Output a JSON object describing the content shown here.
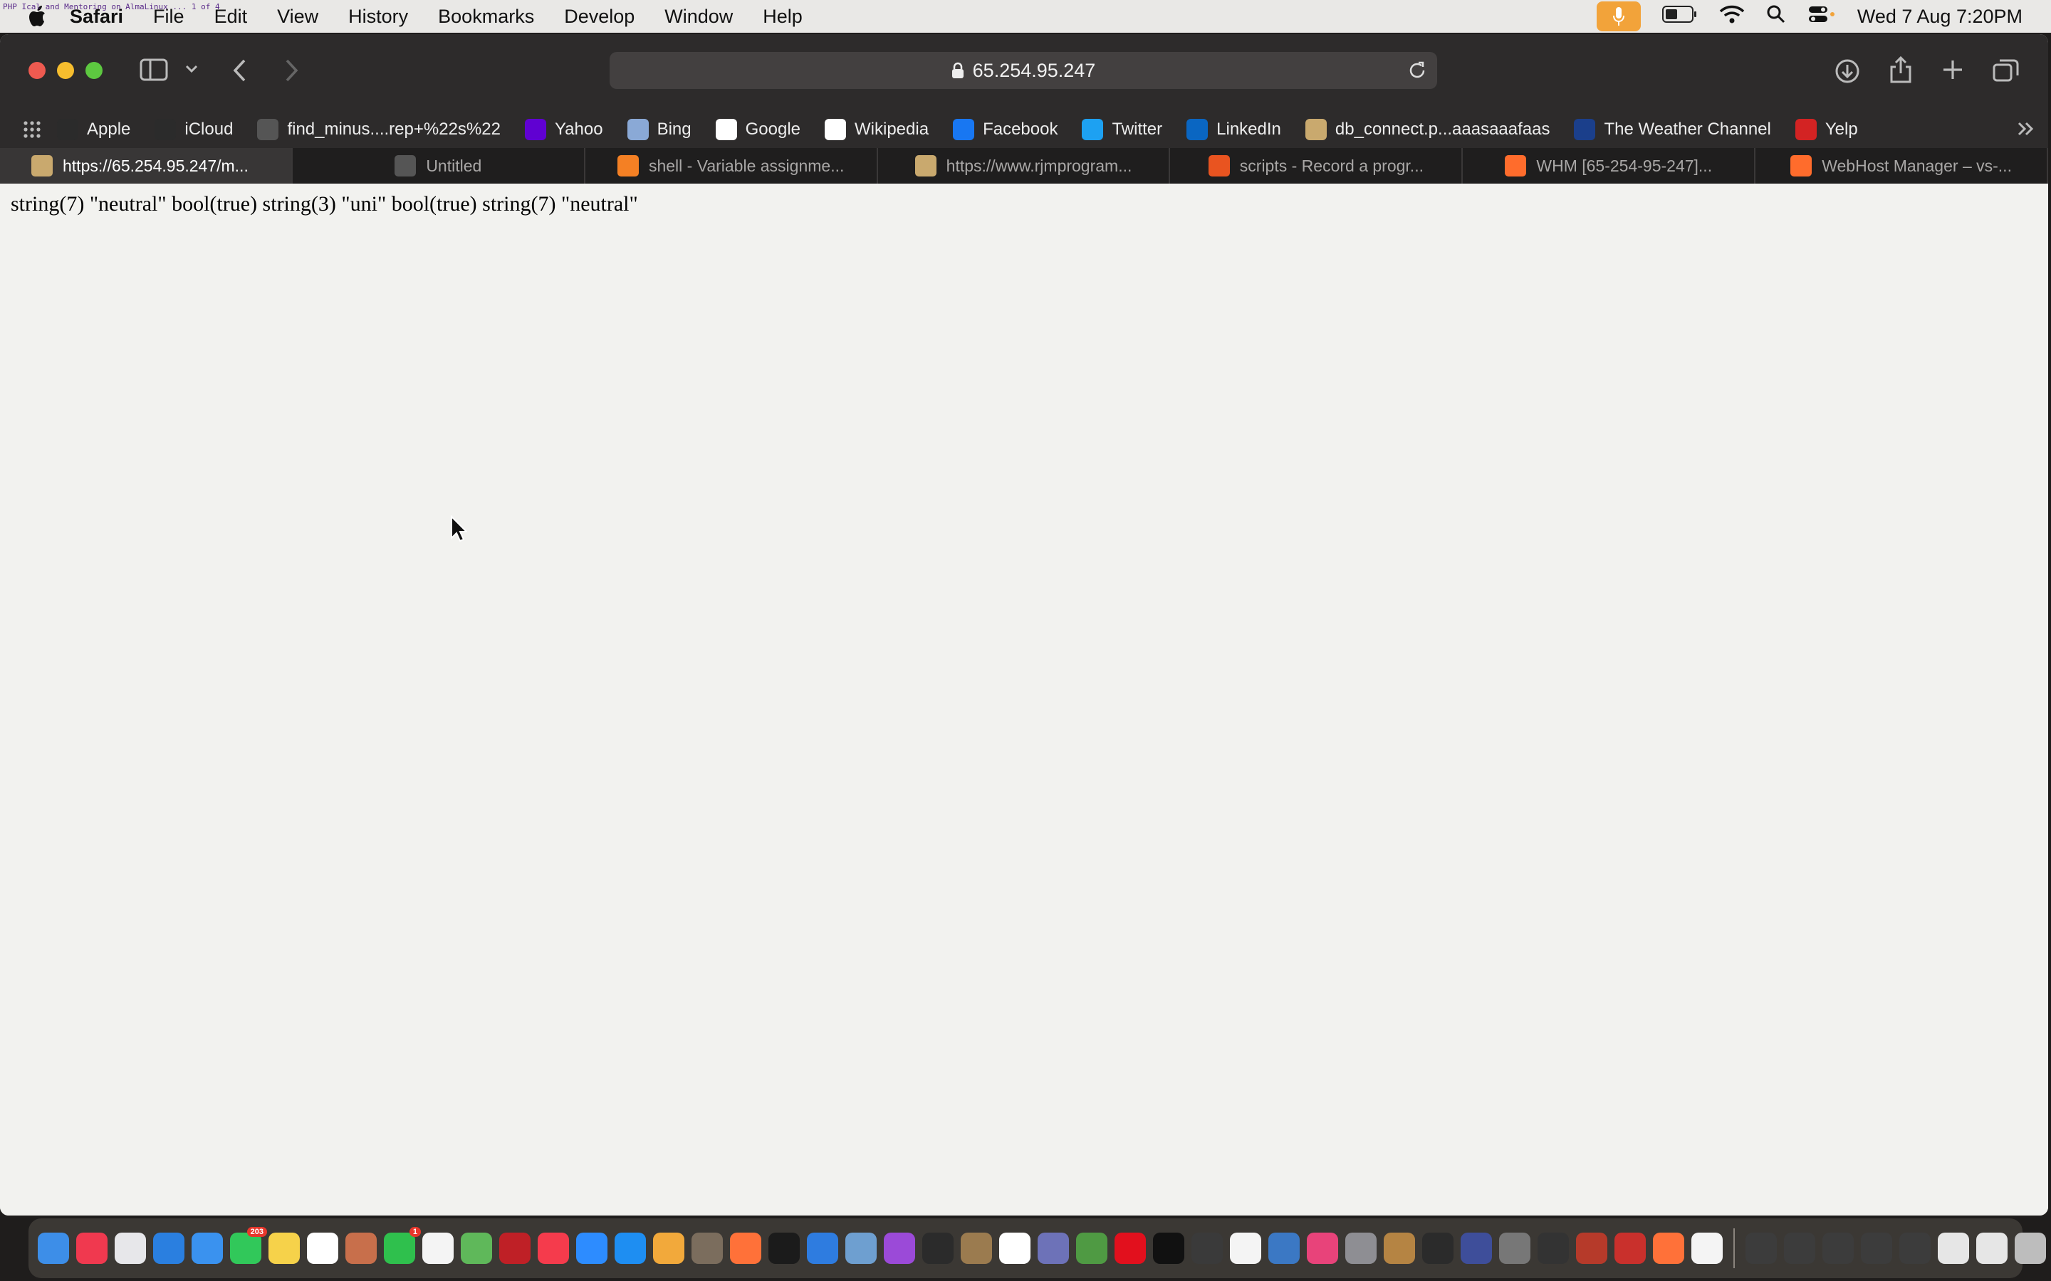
{
  "menubar": {
    "app_name": "Safari",
    "items": [
      "File",
      "Edit",
      "View",
      "History",
      "Bookmarks",
      "Develop",
      "Window",
      "Help"
    ],
    "overlay_text": "PHP Ical and Mentoring on AlmaLinux ... 1 of 4",
    "datetime": "Wed 7 Aug  7:20PM"
  },
  "toolbar": {
    "url": "65.254.95.247"
  },
  "bookmarks": [
    {
      "label": "Apple",
      "icon": "apple-icon",
      "color": "#2b2b2b"
    },
    {
      "label": "iCloud",
      "icon": "apple-icon",
      "color": "#2b2b2b"
    },
    {
      "label": "find_minus....rep+%22s%22",
      "icon": "github-icon",
      "color": "#555555"
    },
    {
      "label": "Yahoo",
      "icon": "yahoo-icon",
      "color": "#6001d2"
    },
    {
      "label": "Bing",
      "icon": "search-icon",
      "color": "#8aa9d6"
    },
    {
      "label": "Google",
      "icon": "google-icon",
      "color": "#ffffff"
    },
    {
      "label": "Wikipedia",
      "icon": "wikipedia-icon",
      "color": "#ffffff"
    },
    {
      "label": "Facebook",
      "icon": "facebook-icon",
      "color": "#1877f2"
    },
    {
      "label": "Twitter",
      "icon": "twitter-icon",
      "color": "#1da1f2"
    },
    {
      "label": "LinkedIn",
      "icon": "linkedin-icon",
      "color": "#0a66c2"
    },
    {
      "label": "db_connect.p...aaasaaafaas",
      "icon": "page-icon",
      "color": "#c9a96e"
    },
    {
      "label": "The Weather Channel",
      "icon": "weather-icon",
      "color": "#1b3f8b"
    },
    {
      "label": "Yelp",
      "icon": "yelp-icon",
      "color": "#d32323"
    }
  ],
  "tabs": [
    {
      "label": "https://65.254.95.247/m...",
      "icon": "page-icon",
      "color": "#c9a96e",
      "active": true
    },
    {
      "label": "Untitled",
      "icon": "compass-icon",
      "color": "#555555",
      "active": false
    },
    {
      "label": "shell - Variable assignme...",
      "icon": "stackoverflow-icon",
      "color": "#f48024",
      "active": false
    },
    {
      "label": "https://www.rjmprogram...",
      "icon": "page-icon",
      "color": "#c9a96e",
      "active": false
    },
    {
      "label": "scripts - Record a progr...",
      "icon": "askubuntu-icon",
      "color": "#e95420",
      "active": false
    },
    {
      "label": "WHM [65-254-95-247]...",
      "icon": "cpanel-icon",
      "color": "#ff6c2c",
      "active": false
    },
    {
      "label": "WebHost Manager – vs-...",
      "icon": "cpanel-icon",
      "color": "#ff6c2c",
      "active": false
    }
  ],
  "content": {
    "output": "string(7) \"neutral\" bool(true) string(3) \"uni\" bool(true) string(7) \"neutral\""
  },
  "dock": [
    {
      "name": "finder-icon",
      "color": "#3d8ee8"
    },
    {
      "name": "music-icon",
      "color": "#f0394f"
    },
    {
      "name": "launchpad-icon",
      "color": "#e7e7ea"
    },
    {
      "name": "safari-icon",
      "color": "#2a7fe0"
    },
    {
      "name": "mail-icon",
      "color": "#3a92ef"
    },
    {
      "name": "messages-icon",
      "color": "#31c85a",
      "badge": "203"
    },
    {
      "name": "notes-icon",
      "color": "#f6d24a"
    },
    {
      "name": "freeform-icon",
      "color": "#ffffff"
    },
    {
      "name": "mission-control-icon",
      "color": "#c86f4b"
    },
    {
      "name": "facetime-icon",
      "color": "#2fc04d",
      "badge": "1"
    },
    {
      "name": "document-icon",
      "color": "#f4f4f4"
    },
    {
      "name": "maps-icon",
      "color": "#5fb85a"
    },
    {
      "name": "filezilla-icon",
      "color": "#bf2026"
    },
    {
      "name": "news-icon",
      "color": "#f53b4c"
    },
    {
      "name": "zoom-icon",
      "color": "#2d8cff"
    },
    {
      "name": "app-store-icon",
      "color": "#1e8ef2"
    },
    {
      "name": "photos-icon",
      "color": "#f2a93b"
    },
    {
      "name": "gimp-icon",
      "color": "#7b6d5d"
    },
    {
      "name": "firefox-icon",
      "color": "#ff7139"
    },
    {
      "name": "apple-tv-icon",
      "color": "#1b1b1b"
    },
    {
      "name": "xcode-icon",
      "color": "#2e7ce0"
    },
    {
      "name": "preview-icon",
      "color": "#6e9fd0"
    },
    {
      "name": "podcasts-icon",
      "color": "#9b4ad8"
    },
    {
      "name": "terminal-icon",
      "color": "#2b2b2b"
    },
    {
      "name": "archive-icon",
      "color": "#9b7b4f"
    },
    {
      "name": "calendar-icon",
      "color": "#ffffff"
    },
    {
      "name": "bbedit-icon",
      "color": "#6d72b8"
    },
    {
      "name": "chrome-icon",
      "color": "#4f9a43"
    },
    {
      "name": "opera-icon",
      "color": "#e2101d"
    },
    {
      "name": "terminal-icon",
      "color": "#111111"
    },
    {
      "name": "calculator-icon",
      "color": "#3a3a3a"
    },
    {
      "name": "textedit-icon",
      "color": "#f4f4f4"
    },
    {
      "name": "quicktime-icon",
      "color": "#3b78c4"
    },
    {
      "name": "intellij-icon",
      "color": "#e8437a"
    },
    {
      "name": "system-settings-icon",
      "color": "#8e8e93"
    },
    {
      "name": "chess-icon",
      "color": "#b58443"
    },
    {
      "name": "console-icon",
      "color": "#2b2b2b"
    },
    {
      "name": "inkscape-icon",
      "color": "#3e4e9a"
    },
    {
      "name": "tableplus-icon",
      "color": "#777777"
    },
    {
      "name": "vpn-icon",
      "color": "#333333"
    },
    {
      "name": "dictionary-icon",
      "color": "#b63a2a"
    },
    {
      "name": "flashcard-icon",
      "color": "#c9302c"
    },
    {
      "name": "firefox-icon",
      "color": "#ff7139"
    },
    {
      "name": "audio-file-icon",
      "color": "#f4f4f4"
    },
    {
      "name": "screenshot-icon",
      "color": "#3c3c3c"
    },
    {
      "name": "screenshot-icon",
      "color": "#3c3c3c"
    },
    {
      "name": "screenshot-icon",
      "color": "#3c3c3c"
    },
    {
      "name": "screenshot-icon",
      "color": "#3c3c3c"
    },
    {
      "name": "screenshot-icon",
      "color": "#3c3c3c"
    },
    {
      "name": "image-file-icon",
      "color": "#e6e6e6"
    },
    {
      "name": "image-file-icon",
      "color": "#e6e6e6"
    },
    {
      "name": "trash-icon",
      "color": "#bdbdbd"
    }
  ]
}
